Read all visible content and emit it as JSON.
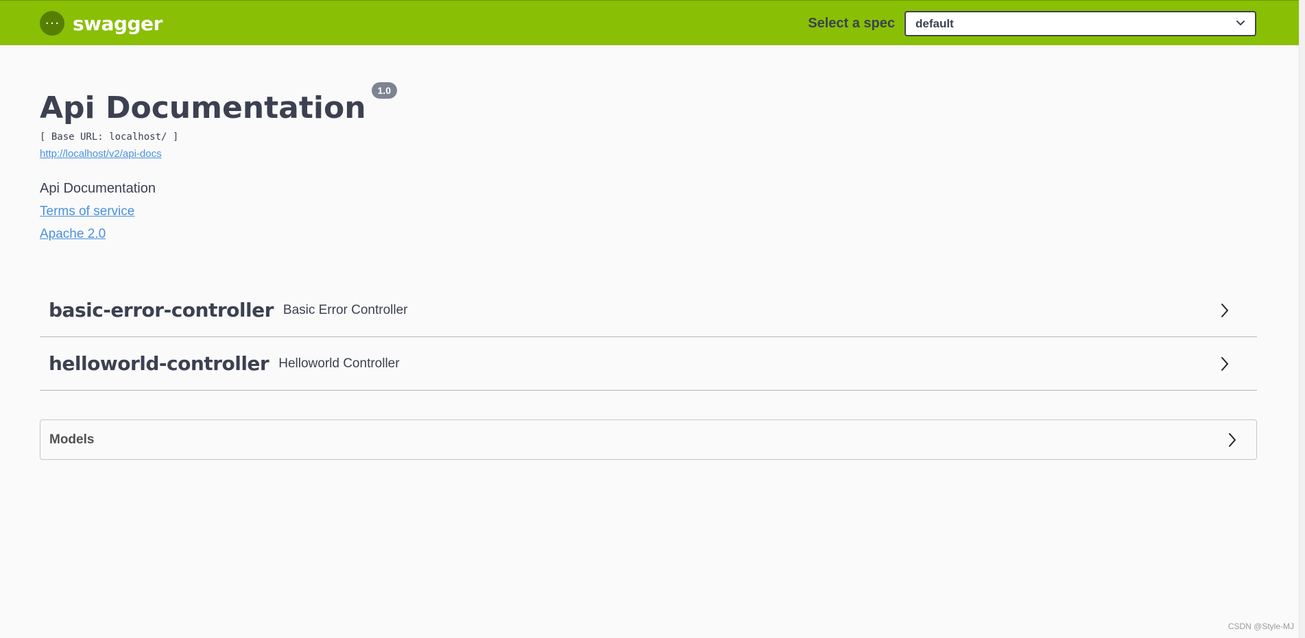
{
  "topbar": {
    "logo_text": "swagger",
    "spec_label": "Select a spec",
    "spec_value": "default"
  },
  "info": {
    "title": "Api Documentation",
    "version": "1.0",
    "base_url": "[ Base URL: localhost/ ]",
    "api_docs_link": "http://localhost/v2/api-docs",
    "description": "Api Documentation",
    "terms_of_service": "Terms of service",
    "license": "Apache 2.0"
  },
  "tags": [
    {
      "name": "basic-error-controller",
      "description": "Basic Error Controller"
    },
    {
      "name": "helloworld-controller",
      "description": "Helloworld Controller"
    }
  ],
  "models": {
    "label": "Models"
  },
  "watermark": "CSDN @Style-MJ",
  "colors": {
    "topbar_bg": "#89bf04",
    "link": "#4990e2",
    "text": "#3b4151",
    "badge": "#7d8492"
  }
}
